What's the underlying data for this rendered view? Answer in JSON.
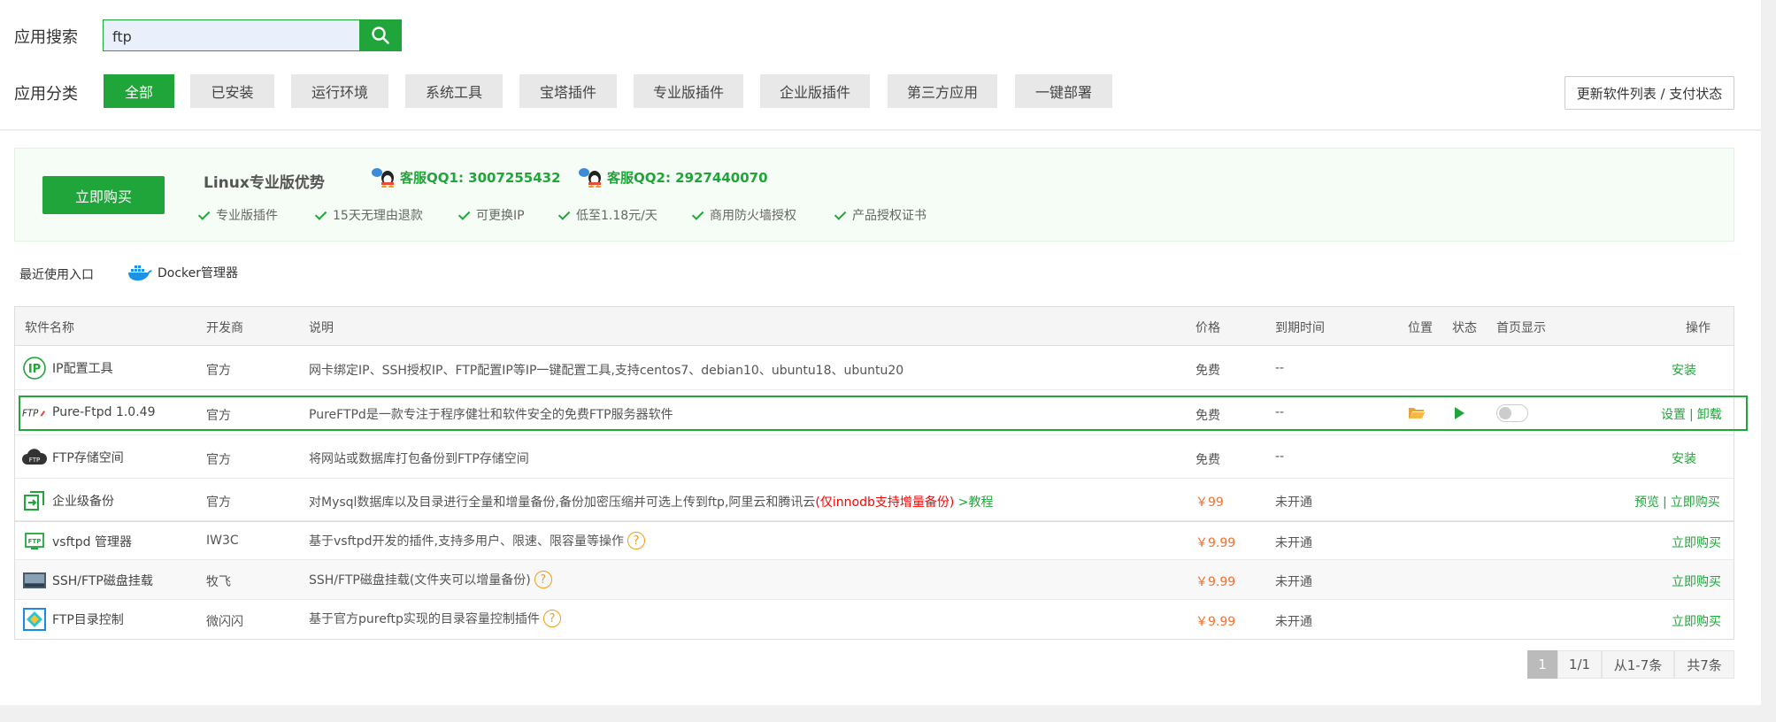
{
  "search": {
    "label": "应用搜索",
    "value": "ftp"
  },
  "categories": {
    "label": "应用分类",
    "items": [
      "全部",
      "已安装",
      "运行环境",
      "系统工具",
      "宝塔插件",
      "专业版插件",
      "企业版插件",
      "第三方应用",
      "一键部署"
    ],
    "active": "全部"
  },
  "update_button": "更新软件列表 / 支付状态",
  "promo": {
    "buy_label": "立即购买",
    "title": "Linux专业版优势",
    "qq1": "客服QQ1: 3007255432",
    "qq2": "客服QQ2: 2927440070",
    "features": [
      "专业版插件",
      "15天无理由退款",
      "可更换IP",
      "低至1.18元/天",
      "商用防火墙授权",
      "产品授权证书"
    ]
  },
  "recent": {
    "label": "最近使用入口",
    "docker": "Docker管理器"
  },
  "table": {
    "headers": [
      "软件名称",
      "开发商",
      "说明",
      "价格",
      "到期时间",
      "位置",
      "状态",
      "首页显示",
      "操作"
    ],
    "rows": [
      {
        "name": "IP配置工具",
        "dev": "官方",
        "desc": "网卡绑定IP、SSH授权IP、FTP配置IP等IP一键配置工具,支持centos7、debian10、ubuntu18、ubuntu20",
        "price": "免费",
        "expire": "--",
        "action1": "安装"
      },
      {
        "name": "Pure-Ftpd 1.0.49",
        "dev": "官方",
        "desc": "PureFTPd是一款专注于程序健壮和软件安全的免费FTP服务器软件",
        "price": "免费",
        "expire": "--",
        "action1": "设置",
        "sep": "|",
        "action2": "卸载"
      },
      {
        "name": "FTP存储空间",
        "dev": "官方",
        "desc": "将网站或数据库打包备份到FTP存储空间",
        "price": "免费",
        "expire": "--",
        "action1": "安装"
      },
      {
        "name": "企业级备份",
        "dev": "官方",
        "desc": "对Mysql数据库以及目录进行全量和增量备份,备份加密压缩并可选上传到ftp,阿里云和腾讯云",
        "desc_red": "(仅innodb支持增量备份)",
        "desc_link": ">教程",
        "price": "￥99",
        "expire": "未开通",
        "action1": "预览",
        "sep": "|",
        "action2": "立即购买"
      },
      {
        "name": "vsftpd 管理器",
        "dev": "IW3C",
        "desc": "基于vsftpd开发的插件,支持多用户、限速、限容量等操作",
        "help": "?",
        "price": "￥9.99",
        "expire": "未开通",
        "action1": "立即购买"
      },
      {
        "name": "SSH/FTP磁盘挂载",
        "dev": "牧飞",
        "desc": "SSH/FTP磁盘挂载(文件夹可以增量备份)",
        "help": "?",
        "price": "￥9.99",
        "expire": "未开通",
        "action1": "立即购买"
      },
      {
        "name": "FTP目录控制",
        "dev": "微闪闪",
        "desc": "基于官方pureftp实现的目录容量控制插件",
        "help": "?",
        "price": "￥9.99",
        "expire": "未开通",
        "action1": "立即购买"
      }
    ]
  },
  "pagination": {
    "current": "1",
    "pages": "1/1",
    "range": "从1-7条",
    "total": "共7条"
  },
  "colors": {
    "accent": "#20a53a",
    "price": "#fc6d26",
    "warning": "#f39c12"
  }
}
